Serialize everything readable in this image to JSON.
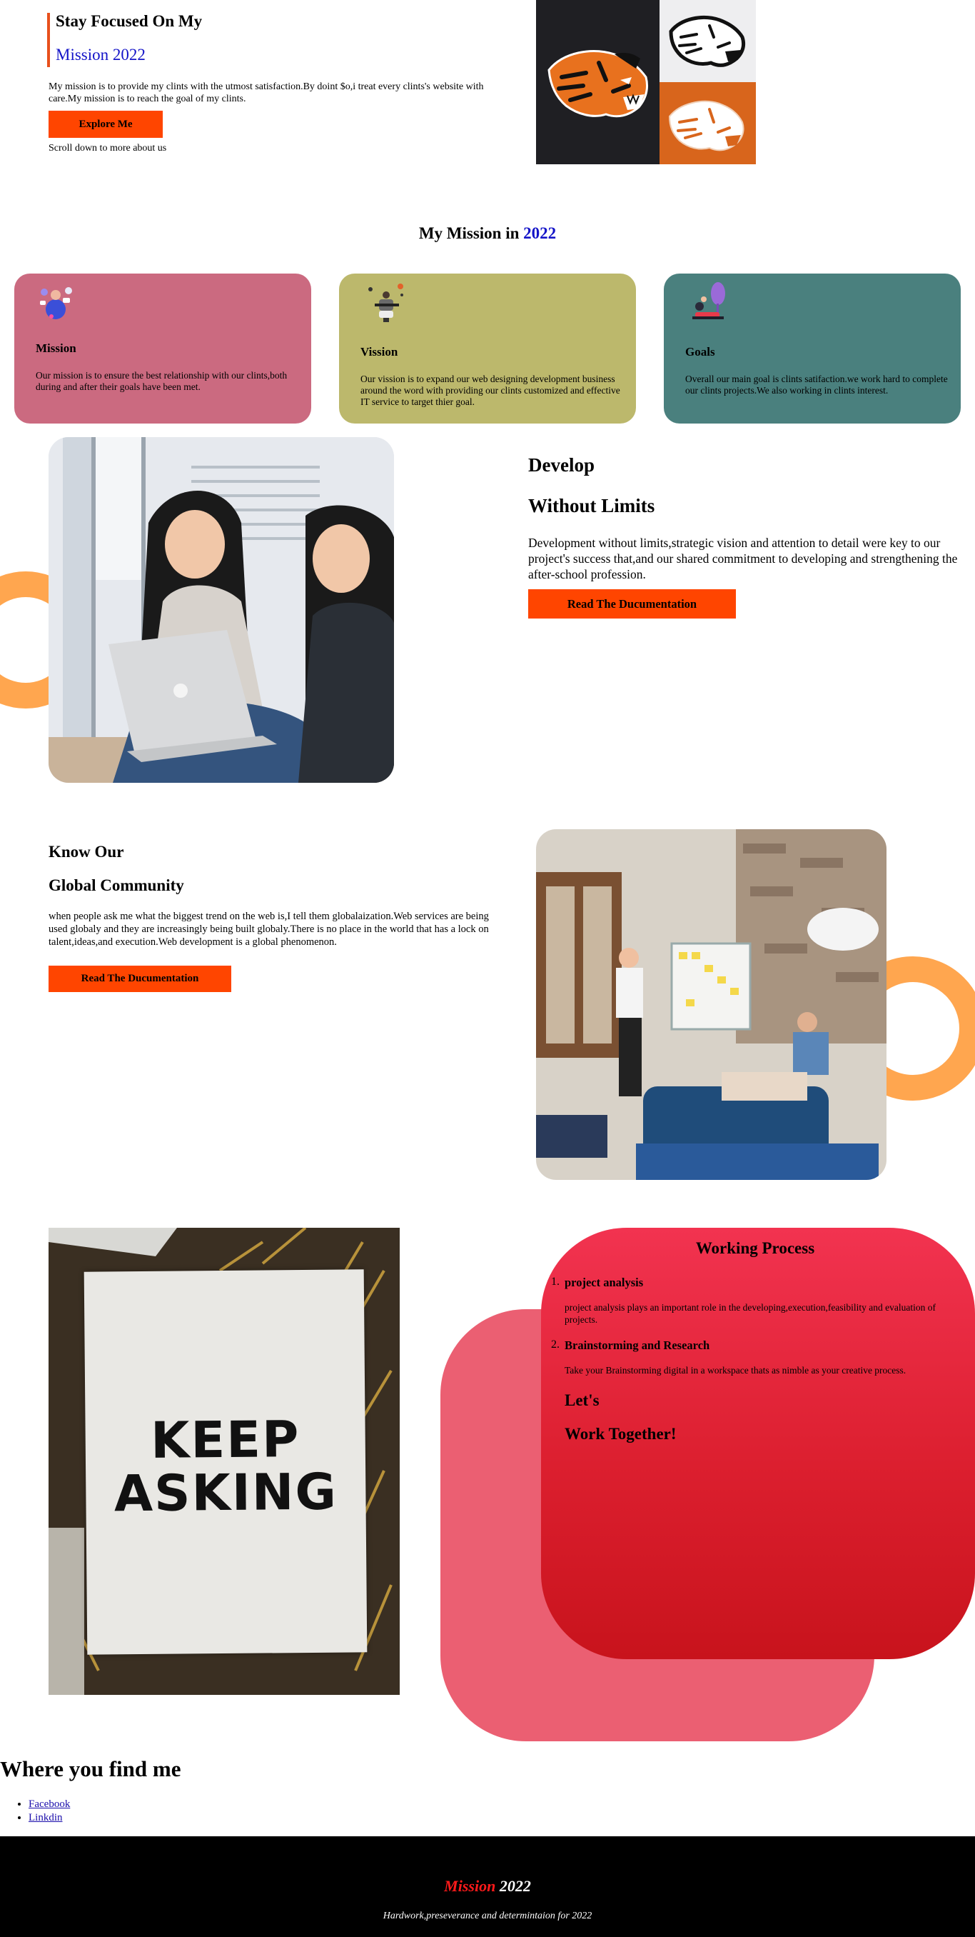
{
  "hero": {
    "title_line1": "Stay Focused On My",
    "title_line2": "Mission 2022",
    "description": "My mission is to provide my clints with the utmost satisfaction.By doint $o,i treat every clints's website with care.My mission is to reach the goal of my clints.",
    "button_label": "Explore Me",
    "scroll_hint": "Scroll down to more about us",
    "logo_colors": {
      "dark": "#1f1f23",
      "light": "#eeeef0",
      "orange": "#d8651c"
    }
  },
  "mission_section": {
    "title_prefix": "My Mission in ",
    "title_year": "2022",
    "cards": [
      {
        "title": "Mission",
        "text": "Our mission is to ensure the best relationship with our clints,both during and after their goals have been met.",
        "color": "#cb6a80",
        "icon": "team-icon"
      },
      {
        "title": "Vission",
        "text": "Our vission is to expand our web designing development business around the word with providing our clints customized and effective IT service to target thier goal.",
        "color": "#bcb86c",
        "icon": "juggler-icon"
      },
      {
        "title": "Goals",
        "text": "Overall our main goal is clints satifaction.we work hard to complete our clints projects.We also working in clints interest.",
        "color": "#4a807e",
        "icon": "goal-person-icon"
      }
    ]
  },
  "develop_section": {
    "title_line1": "Develop",
    "title_line2": "Without Limits",
    "description": "Development without limits,strategic vision and attention to detail were key to our project's success that,and our shared commitment to developing and strengthening the after-school profession.",
    "button_label": "Read The Ducumentation"
  },
  "community_section": {
    "title_line1": "Know Our",
    "title_line2": "Global Community",
    "description": "when people ask me what the biggest trend on the web is,I tell them globalaization.Web services are being used globaly and they are increasingly being built globaly.There is no place in the world that has a lock on talent,ideas,and execution.Web development is a global phenomenon.",
    "button_label": "Read The Ducumentation"
  },
  "poster": {
    "line1": "KEEP",
    "line2": "ASKING"
  },
  "working_process": {
    "title": "Working Process",
    "items": [
      {
        "number": "1.",
        "title": "project analysis",
        "text": "project analysis plays an important role in the developing,execution,feasibility and evaluation of projects."
      },
      {
        "number": "2.",
        "title": "Brainstorming and Research",
        "text": "Take your Brainstorming digital in a workspace thats as nimble as your creative process."
      }
    ],
    "cta_line1": "Let's",
    "cta_line2": "Work Together!"
  },
  "find_me": {
    "title": "Where you find me",
    "links": [
      "Facebook",
      "Linkdin"
    ]
  },
  "footer": {
    "title_red": "Mission",
    "title_white": " 2022",
    "subtitle": "Hardwork,preseverance and determintaion for 2022"
  },
  "colors": {
    "accent": "#ff4500",
    "year_blue": "#1414c8",
    "ring": "#ffa64f",
    "footer_bg": "#000000"
  }
}
